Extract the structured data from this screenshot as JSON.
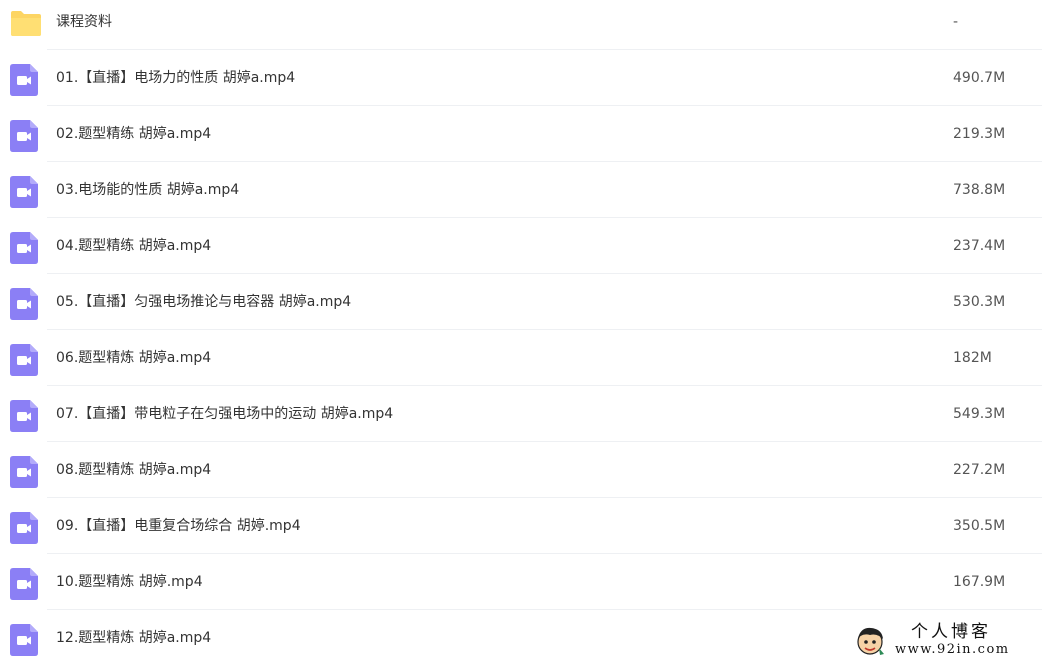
{
  "colors": {
    "folder": "#fdd563",
    "video_icon": "#8b7ff5",
    "divider": "#eef0f3"
  },
  "files": [
    {
      "type": "folder",
      "icon": "folder-icon",
      "name": "课程资料",
      "size": "-"
    },
    {
      "type": "video",
      "icon": "video-file-icon",
      "name": "01.【直播】电场力的性质 胡婷a.mp4",
      "size": "490.7M"
    },
    {
      "type": "video",
      "icon": "video-file-icon",
      "name": "02.题型精练 胡婷a.mp4",
      "size": "219.3M"
    },
    {
      "type": "video",
      "icon": "video-file-icon",
      "name": "03.电场能的性质 胡婷a.mp4",
      "size": "738.8M"
    },
    {
      "type": "video",
      "icon": "video-file-icon",
      "name": "04.题型精练 胡婷a.mp4",
      "size": "237.4M"
    },
    {
      "type": "video",
      "icon": "video-file-icon",
      "name": "05.【直播】匀强电场推论与电容器 胡婷a.mp4",
      "size": "530.3M"
    },
    {
      "type": "video",
      "icon": "video-file-icon",
      "name": "06.题型精炼 胡婷a.mp4",
      "size": "182M"
    },
    {
      "type": "video",
      "icon": "video-file-icon",
      "name": "07.【直播】带电粒子在匀强电场中的运动 胡婷a.mp4",
      "size": "549.3M"
    },
    {
      "type": "video",
      "icon": "video-file-icon",
      "name": "08.题型精炼 胡婷a.mp4",
      "size": "227.2M"
    },
    {
      "type": "video",
      "icon": "video-file-icon",
      "name": "09.【直播】电重复合场综合 胡婷.mp4",
      "size": "350.5M"
    },
    {
      "type": "video",
      "icon": "video-file-icon",
      "name": "10.题型精炼 胡婷.mp4",
      "size": "167.9M"
    },
    {
      "type": "video",
      "icon": "video-file-icon",
      "name": "12.题型精炼 胡婷a.mp4",
      "size": ""
    }
  ],
  "watermark": {
    "title": "个人博客",
    "url": "www.92in.com"
  }
}
